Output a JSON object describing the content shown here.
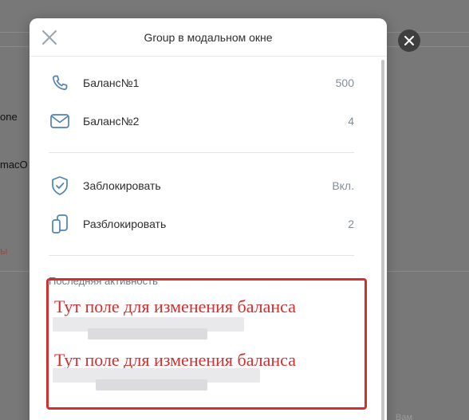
{
  "background": {
    "snippet_1": "one",
    "snippet_2": "macO",
    "snippet_3": "ы",
    "snippet_4": "Вам"
  },
  "modal": {
    "title": "Group в модальном окне",
    "rows": [
      {
        "label": "Баланс№1",
        "value": "500",
        "icon": "phone-icon"
      },
      {
        "label": "Баланс№2",
        "value": "4",
        "icon": "mail-icon"
      },
      {
        "label": "Заблокировать",
        "value": "Вкл.",
        "icon": "shield-check-icon"
      },
      {
        "label": "Разблокировать",
        "value": "2",
        "icon": "devices-icon"
      }
    ],
    "section_header": "Последняя активность"
  },
  "annotation": {
    "line_1": "Тут поле для изменения баланса",
    "line_2": "Тут поле для изменения баланса"
  },
  "colors": {
    "accent": "#5181b8",
    "annotation": "#d32f2f",
    "secondary_text": "#818c99"
  }
}
